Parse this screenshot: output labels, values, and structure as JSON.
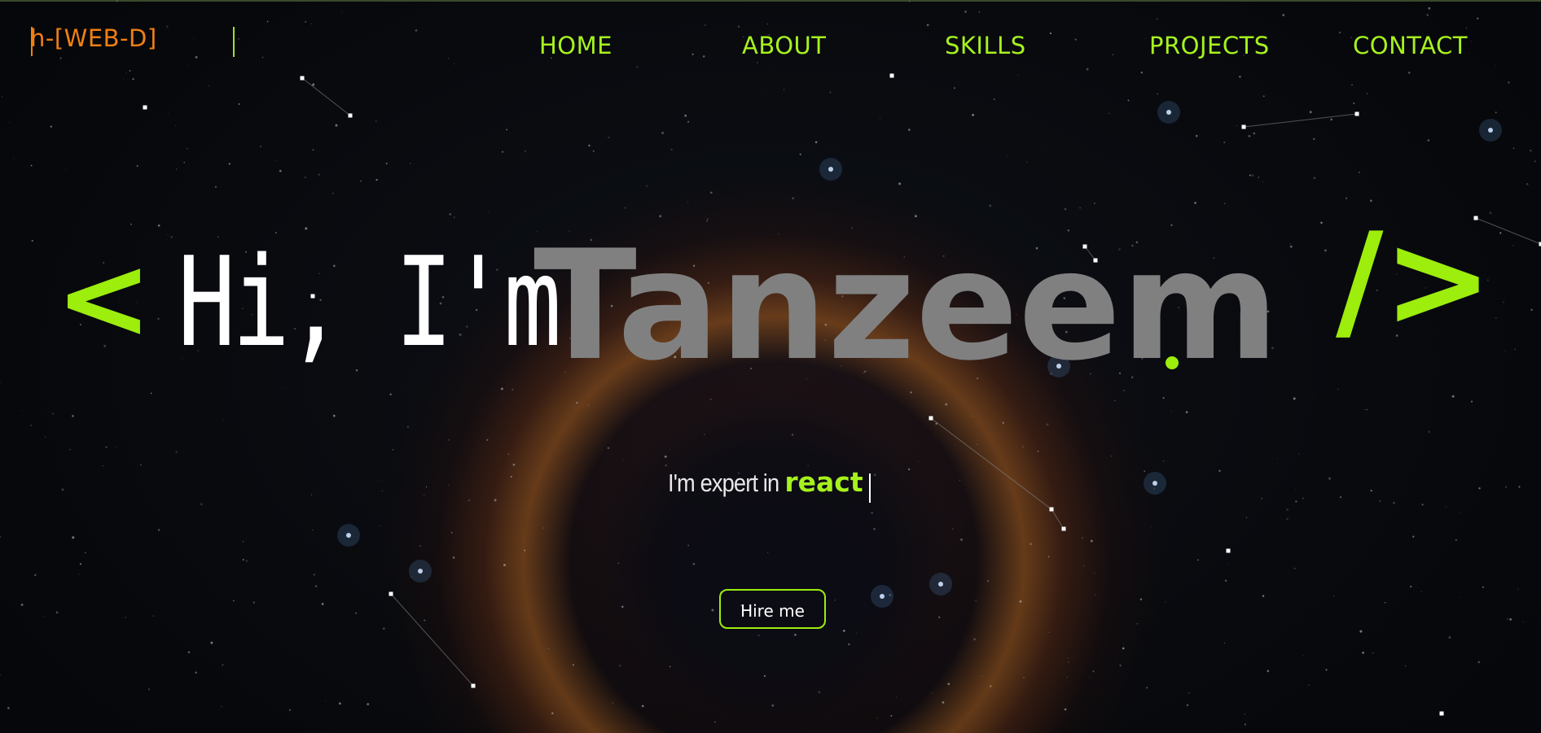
{
  "header": {
    "logo_text": "h-[WEB-D]"
  },
  "nav": {
    "items": [
      {
        "label": "HOME"
      },
      {
        "label": "ABOUT"
      },
      {
        "label": "SKILLS"
      },
      {
        "label": "PROJECTS"
      },
      {
        "label": "CONTACT"
      }
    ]
  },
  "hero": {
    "open_bracket": "<",
    "greeting": "Hi, I'm",
    "name": "Tanzeem",
    "close_bracket": "/>",
    "subtitle_prefix": "I'm expert in",
    "typed_word": "react",
    "cta_label": "Hire me"
  },
  "colors": {
    "accent": "#9ded0d",
    "logo": "#f07f14",
    "name": "#808080",
    "background": "#07080b"
  },
  "icons": {
    "background": "space-nebula-starfield"
  }
}
